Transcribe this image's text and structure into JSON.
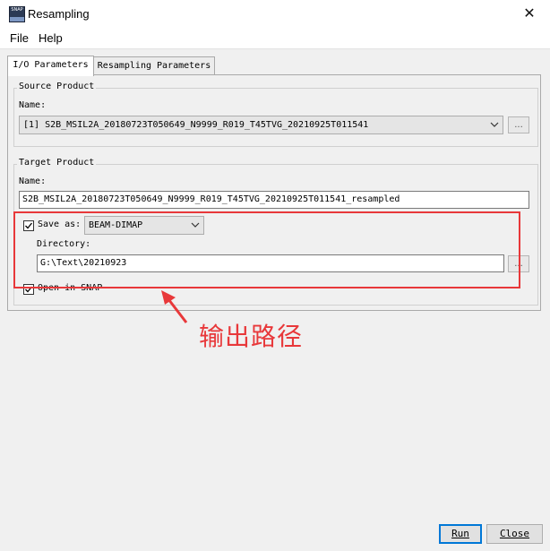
{
  "window": {
    "title": "Resampling",
    "app_icon_text": "SNAP",
    "close_glyph": "✕"
  },
  "menu": {
    "items": [
      "File",
      "Help"
    ]
  },
  "tabs": [
    {
      "label": "I/O Parameters",
      "active": true
    },
    {
      "label": "Resampling Parameters",
      "active": false
    }
  ],
  "source_product": {
    "group_title": "Source Product",
    "name_label": "Name:",
    "selected": "[1] S2B_MSIL2A_20180723T050649_N9999_R019_T45TVG_20210925T011541",
    "browse_label": "..."
  },
  "target_product": {
    "group_title": "Target Product",
    "name_label": "Name:",
    "name_value": "S2B_MSIL2A_20180723T050649_N9999_R019_T45TVG_20210925T011541_resampled",
    "save_as_label": "Save as:",
    "save_as_checked": true,
    "format": "BEAM-DIMAP",
    "directory_label": "Directory:",
    "directory_value": "G:\\Text\\20210923",
    "browse_label": "...",
    "open_in_snap_label": "Open in SNAP",
    "open_in_snap_checked": true
  },
  "annotation": {
    "text": "输出路径",
    "color": "#e8383a"
  },
  "buttons": {
    "run": "Run",
    "close": "Close"
  },
  "icons": {
    "dropdown": "chevron-down-icon",
    "check": "check-icon",
    "arrow": "arrow-icon"
  }
}
